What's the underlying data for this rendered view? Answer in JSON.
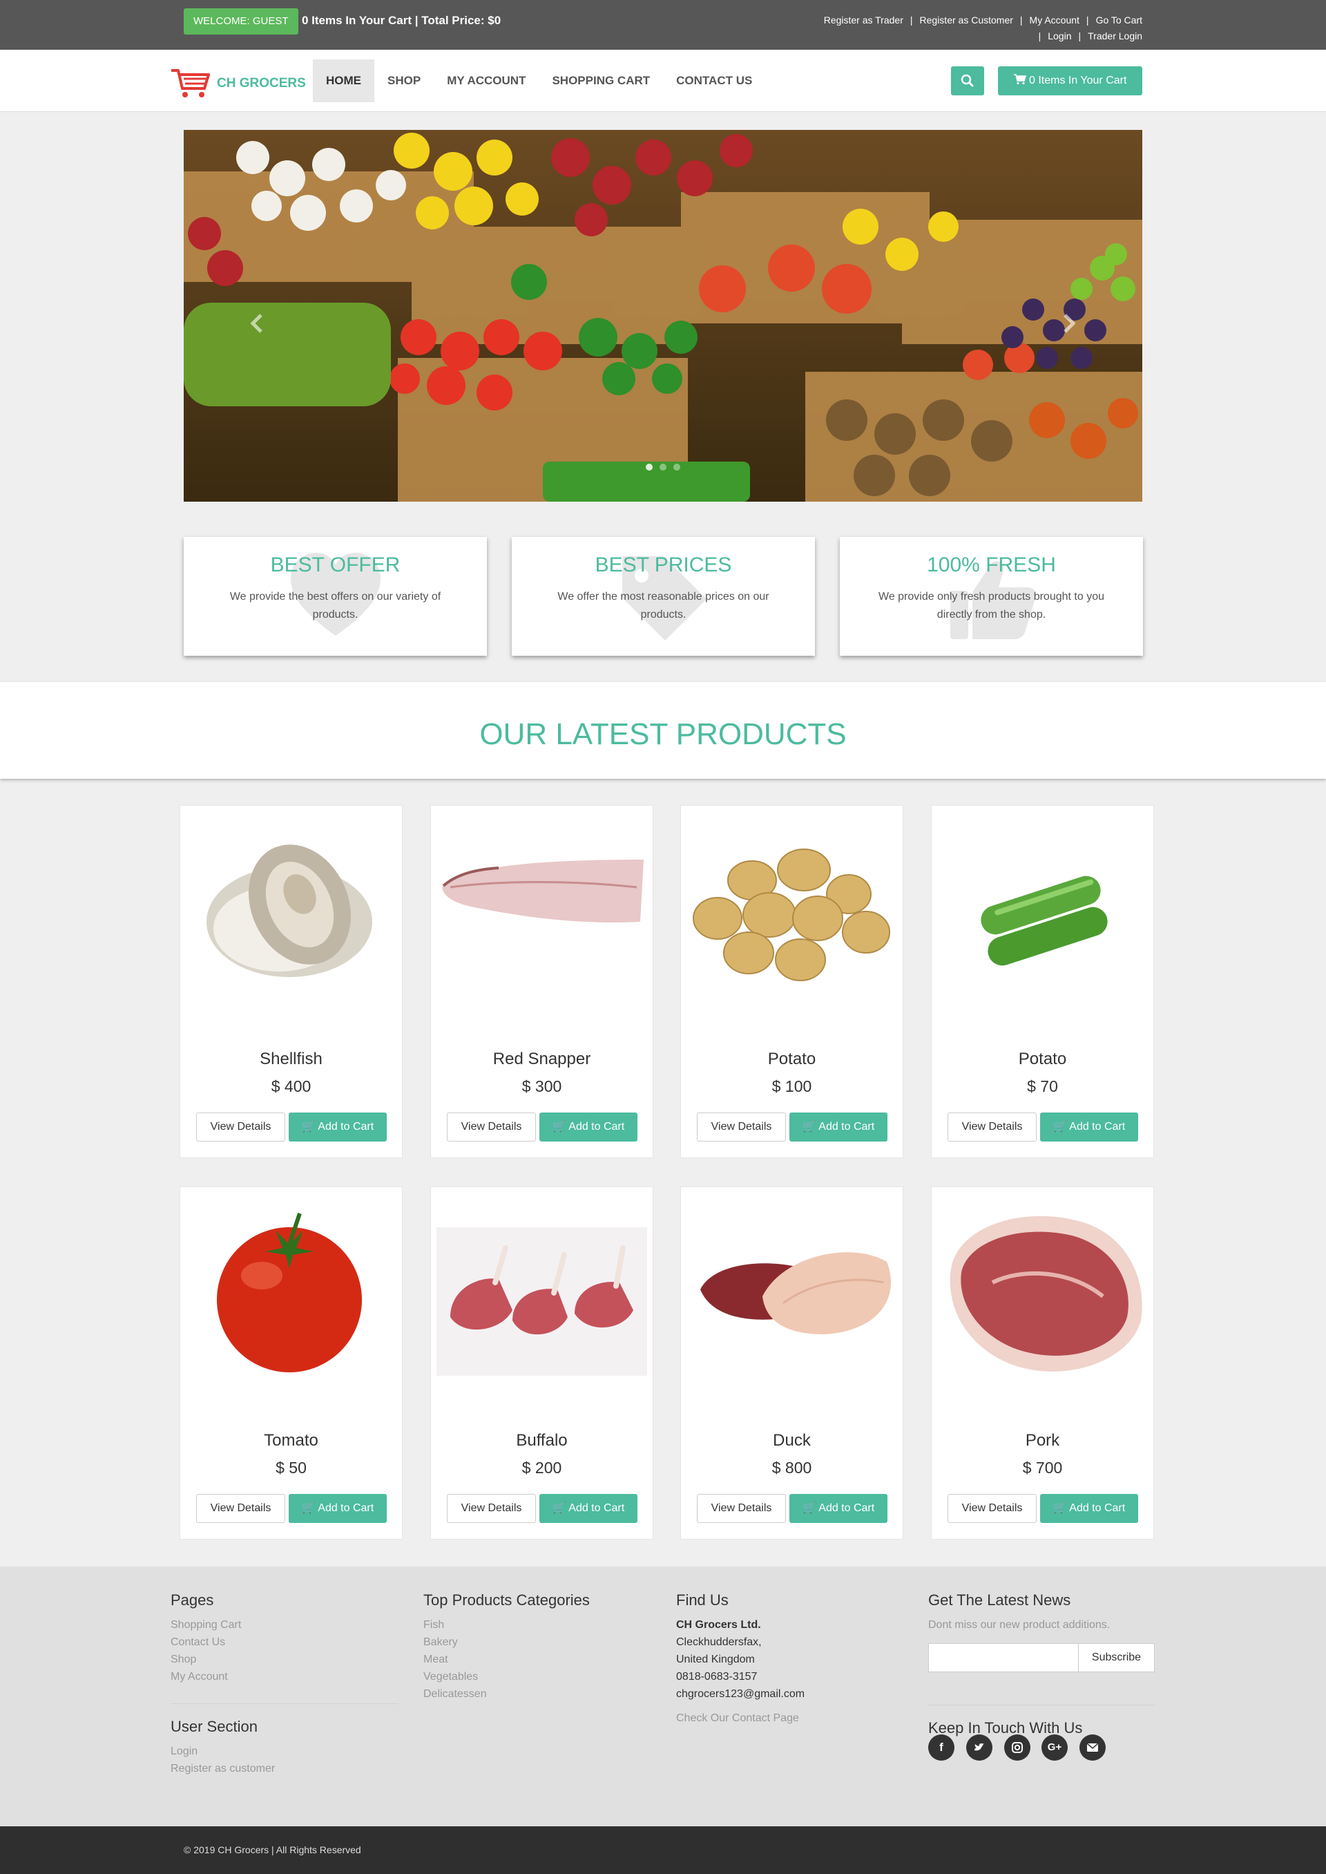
{
  "topbar": {
    "welcome": "WELCOME: GUEST",
    "cart_summary": "0 Items In Your Cart | Total Price: $0",
    "links_row1": [
      "Register as Trader",
      "Register as Customer",
      "My Account",
      "Go To Cart"
    ],
    "links_row2": [
      "Login",
      "Trader Login"
    ]
  },
  "navbar": {
    "logo_text": "CH GROCERS",
    "items": [
      "HOME",
      "SHOP",
      "MY ACCOUNT",
      "SHOPPING CART",
      "CONTACT US"
    ],
    "cart_button": "0 Items In Your Cart"
  },
  "features": [
    {
      "title": "BEST OFFER",
      "text": "We provide the best offers on our variety of products."
    },
    {
      "title": "BEST PRICES",
      "text": "We offer the most reasonable prices on our products."
    },
    {
      "title": "100% FRESH",
      "text": "We provide only fresh products brought to you directly from the shop."
    }
  ],
  "latest_title": "OUR LATEST PRODUCTS",
  "products": [
    {
      "name": "Shellfish",
      "price": "$ 400"
    },
    {
      "name": "Red Snapper",
      "price": "$ 300"
    },
    {
      "name": "Potato",
      "price": "$ 100"
    },
    {
      "name": "Potato",
      "price": "$ 70"
    },
    {
      "name": "Tomato",
      "price": "$ 50"
    },
    {
      "name": "Buffalo",
      "price": "$ 200"
    },
    {
      "name": "Duck",
      "price": "$ 800"
    },
    {
      "name": "Pork",
      "price": "$ 700"
    }
  ],
  "product_buttons": {
    "view": "View Details",
    "add": "Add to Cart"
  },
  "footer": {
    "pages_title": "Pages",
    "pages": [
      "Shopping Cart",
      "Contact Us",
      "Shop",
      "My Account"
    ],
    "user_title": "User Section",
    "user_links": [
      "Login",
      "Register as customer"
    ],
    "categories_title": "Top Products Categories",
    "categories": [
      "Fish",
      "Bakery",
      "Meat",
      "Vegetables",
      "Delicatessen"
    ],
    "find_title": "Find Us",
    "company": "CH Grocers Ltd.",
    "address": [
      "Cleckhuddersfax,",
      "United Kingdom",
      "0818-0683-3157",
      "chgrocers123@gmail.com"
    ],
    "contact_link": "Check Our Contact Page",
    "news_title": "Get The Latest News",
    "news_text": "Dont miss our new product additions.",
    "subscribe": "Subscribe",
    "keep_title": "Keep In Touch With Us"
  },
  "copyright": "© 2019 CH Grocers | All Rights Reserved",
  "colors": {
    "accent": "#4cbb9e",
    "welcome": "#5cb85c",
    "topbar": "#575757"
  }
}
